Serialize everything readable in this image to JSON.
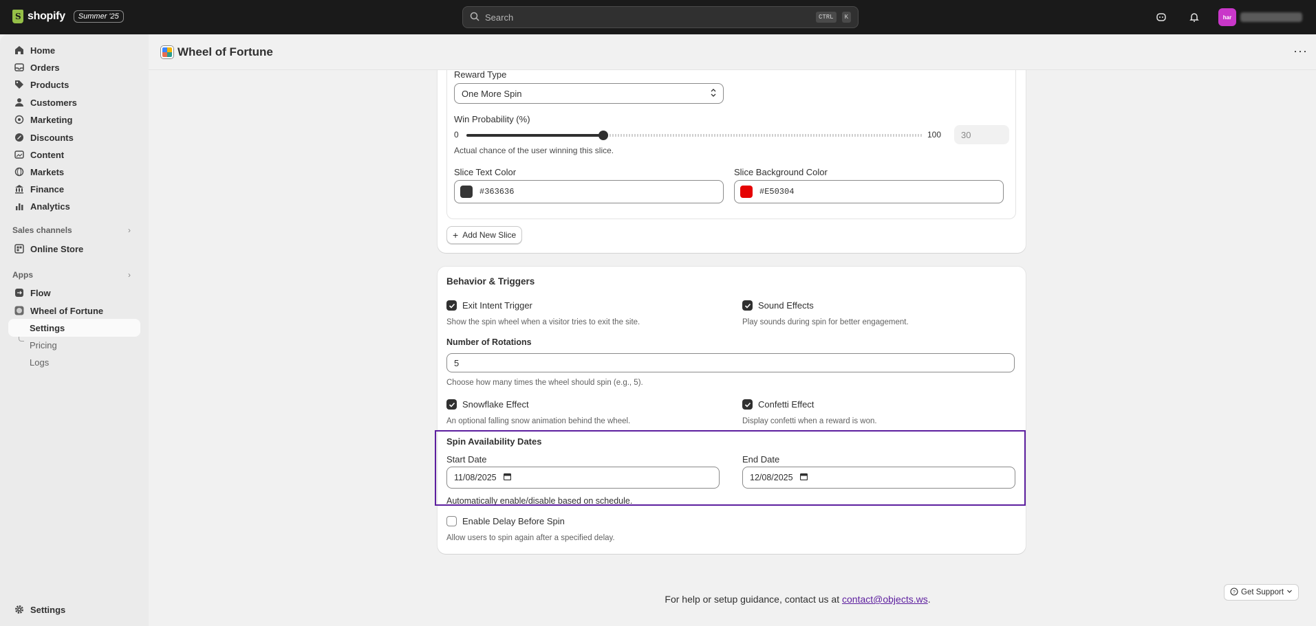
{
  "topbar": {
    "logo_text": "shopify",
    "edition_badge": "Summer '25",
    "search_placeholder": "Search",
    "shortcut_key1": "CTRL",
    "shortcut_key2": "K",
    "avatar_initials": "har"
  },
  "sidebar": {
    "items": [
      {
        "label": "Home",
        "icon": "home-icon"
      },
      {
        "label": "Orders",
        "icon": "inbox-icon"
      },
      {
        "label": "Products",
        "icon": "tag-icon"
      },
      {
        "label": "Customers",
        "icon": "person-icon"
      },
      {
        "label": "Marketing",
        "icon": "target-icon"
      },
      {
        "label": "Discounts",
        "icon": "discount-icon"
      },
      {
        "label": "Content",
        "icon": "content-icon"
      },
      {
        "label": "Markets",
        "icon": "globe-icon"
      },
      {
        "label": "Finance",
        "icon": "bank-icon"
      },
      {
        "label": "Analytics",
        "icon": "chart-icon"
      }
    ],
    "sales_channels_label": "Sales channels",
    "online_store_label": "Online Store",
    "apps_label": "Apps",
    "flow_label": "Flow",
    "app_label": "Wheel of Fortune",
    "sub_items": [
      "Settings",
      "Pricing",
      "Logs"
    ],
    "settings_label": "Settings"
  },
  "page": {
    "title": "Wheel of Fortune"
  },
  "slice": {
    "reward_type_label": "Reward Type",
    "reward_type_value": "One More Spin",
    "win_prob_label": "Win Probability (%)",
    "win_prob_min": "0",
    "win_prob_max": "100",
    "win_prob_value": "30",
    "win_prob_fraction": 0.3,
    "win_prob_help": "Actual chance of the user winning this slice.",
    "text_color_label": "Slice Text Color",
    "text_color_value": "#363636",
    "bg_color_label": "Slice Background Color",
    "bg_color_value": "#E50304",
    "add_slice_label": "Add New Slice"
  },
  "behavior": {
    "title": "Behavior & Triggers",
    "exit_intent_label": "Exit Intent Trigger",
    "exit_intent_help": "Show the spin wheel when a visitor tries to exit the site.",
    "sound_label": "Sound Effects",
    "sound_help": "Play sounds during spin for better engagement.",
    "rotations_label": "Number of Rotations",
    "rotations_value": "5",
    "rotations_help": "Choose how many times the wheel should spin (e.g., 5).",
    "snowflake_label": "Snowflake Effect",
    "snowflake_help": "An optional falling snow animation behind the wheel.",
    "confetti_label": "Confetti Effect",
    "confetti_help": "Display confetti when a reward is won.",
    "dates_title": "Spin Availability Dates",
    "start_label": "Start Date",
    "start_value": "11/08/2025",
    "end_label": "End Date",
    "end_value": "12/08/2025",
    "dates_help": "Automatically enable/disable based on schedule.",
    "delay_label": "Enable Delay Before Spin",
    "delay_help": "Allow users to spin again after a specified delay."
  },
  "footer": {
    "text": "For help or setup guidance, contact us at",
    "email": "contact@objects.ws",
    "period": "."
  },
  "support_label": "Get Support",
  "colors": {
    "text_swatch": "#363636",
    "bg_swatch": "#E50304",
    "highlight": "#5c1e9e"
  }
}
